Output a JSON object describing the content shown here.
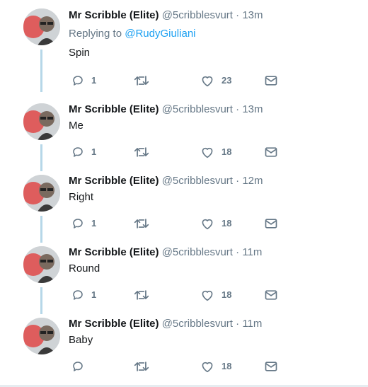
{
  "thread": {
    "colors": {
      "name": "#14171a",
      "muted": "#657786",
      "link": "#1da1f2",
      "thread_line": "#b6d7e8"
    },
    "tweets": [
      {
        "name": "Mr Scribble (Elite)",
        "handle": "@5cribblesvurt",
        "separator": "·",
        "time": "13m",
        "replying_prefix": "Replying to",
        "replying_to": "@RudyGiuliani",
        "text": "Spin",
        "replies": "1",
        "likes": "23"
      },
      {
        "name": "Mr Scribble (Elite)",
        "handle": "@5cribblesvurt",
        "separator": "·",
        "time": "13m",
        "text": "Me",
        "replies": "1",
        "likes": "18"
      },
      {
        "name": "Mr Scribble (Elite)",
        "handle": "@5cribblesvurt",
        "separator": "·",
        "time": "12m",
        "text": "Right",
        "replies": "1",
        "likes": "18"
      },
      {
        "name": "Mr Scribble (Elite)",
        "handle": "@5cribblesvurt",
        "separator": "·",
        "time": "11m",
        "text": "Round",
        "replies": "1",
        "likes": "18"
      },
      {
        "name": "Mr Scribble (Elite)",
        "handle": "@5cribblesvurt",
        "separator": "·",
        "time": "11m",
        "text": "Baby",
        "replies": "",
        "likes": "18"
      }
    ],
    "icons": {
      "reply": "reply-icon",
      "retweet": "retweet-icon",
      "like": "heart-icon",
      "dm": "envelope-icon",
      "avatar": "avatar"
    }
  }
}
